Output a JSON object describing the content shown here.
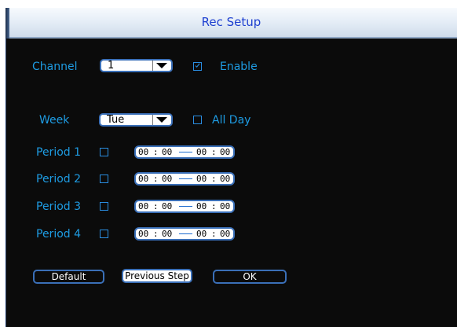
{
  "window": {
    "title": "Rec Setup"
  },
  "channel": {
    "label": "Channel",
    "value": "1",
    "enable_label": "Enable",
    "enable_checked": true
  },
  "week": {
    "label": "Week",
    "value": "Tue",
    "allday_label": "All Day",
    "allday_checked": false
  },
  "periods": [
    {
      "label": "Period 1",
      "checked": false,
      "start_h": "00",
      "start_m": "00",
      "end_h": "00",
      "end_m": "00"
    },
    {
      "label": "Period 2",
      "checked": false,
      "start_h": "00",
      "start_m": "00",
      "end_h": "00",
      "end_m": "00"
    },
    {
      "label": "Period 3",
      "checked": false,
      "start_h": "00",
      "start_m": "00",
      "end_h": "00",
      "end_m": "00"
    },
    {
      "label": "Period 4",
      "checked": false,
      "start_h": "00",
      "start_m": "00",
      "end_h": "00",
      "end_m": "00"
    }
  ],
  "buttons": {
    "default_label": "Default",
    "previous_label": "Previous Step",
    "ok_label": "OK"
  },
  "colors": {
    "accent": "#1e9ce3",
    "border": "#3a6fb8",
    "title_text": "#1d3fd0",
    "background": "#0b0b0b"
  }
}
